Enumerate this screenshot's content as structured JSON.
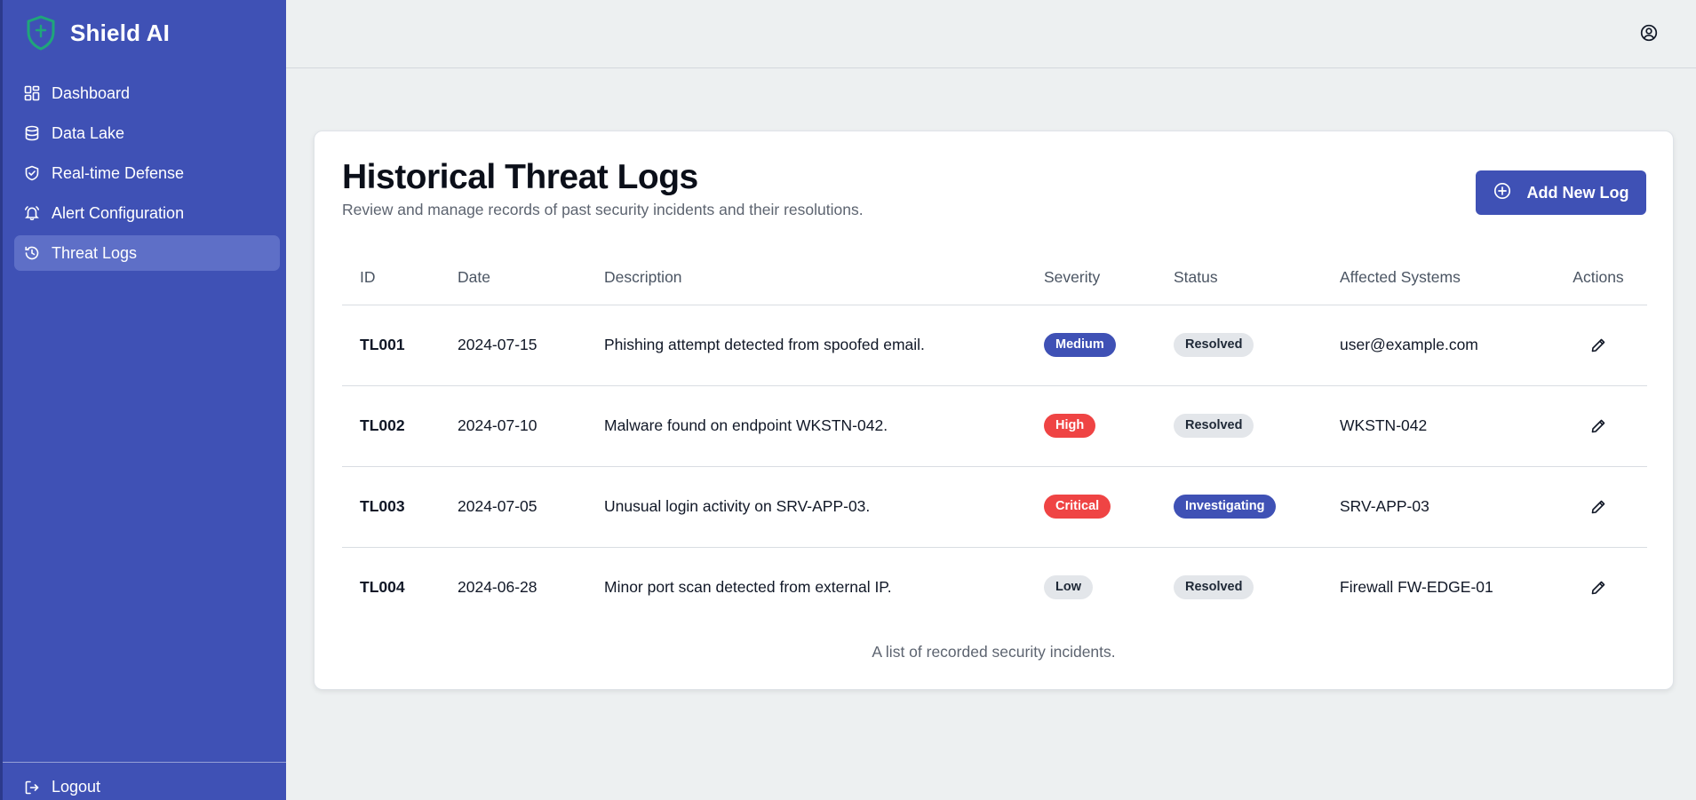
{
  "brand": {
    "name": "Shield AI",
    "icon": "shield-icon",
    "accent": "#3f51b5"
  },
  "sidebar": {
    "items": [
      {
        "label": "Dashboard",
        "icon": "dashboard-grid-icon",
        "active": false
      },
      {
        "label": "Data Lake",
        "icon": "database-icon",
        "active": false
      },
      {
        "label": "Real-time Defense",
        "icon": "shield-check-icon",
        "active": false
      },
      {
        "label": "Alert Configuration",
        "icon": "bell-icon",
        "active": false
      },
      {
        "label": "Threat Logs",
        "icon": "history-icon",
        "active": true
      }
    ],
    "logout_label": "Logout"
  },
  "header": {
    "user_icon": "user-circle-icon"
  },
  "main": {
    "title": "Historical Threat Logs",
    "subtitle": "Review and manage records of past security incidents and their resolutions.",
    "add_button_label": "Add New Log",
    "table": {
      "columns": [
        "ID",
        "Date",
        "Description",
        "Severity",
        "Status",
        "Affected Systems",
        "Actions"
      ],
      "rows": [
        {
          "id": "TL001",
          "date": "2024-07-15",
          "description": "Phishing attempt detected from spoofed email.",
          "severity": "Medium",
          "status": "Resolved",
          "affected": "user@example.com"
        },
        {
          "id": "TL002",
          "date": "2024-07-10",
          "description": "Malware found on endpoint WKSTN-042.",
          "severity": "High",
          "status": "Resolved",
          "affected": "WKSTN-042"
        },
        {
          "id": "TL003",
          "date": "2024-07-05",
          "description": "Unusual login activity on SRV-APP-03.",
          "severity": "Critical",
          "status": "Investigating",
          "affected": "SRV-APP-03"
        },
        {
          "id": "TL004",
          "date": "2024-06-28",
          "description": "Minor port scan detected from external IP.",
          "severity": "Low",
          "status": "Resolved",
          "affected": "Firewall FW-EDGE-01"
        }
      ],
      "caption": "A list of recorded security incidents."
    }
  },
  "colors": {
    "sidebar_bg": "#3f51b5",
    "danger": "#ef4444",
    "neutral_badge": "#e3e6ea",
    "page_bg": "#edf0f1"
  }
}
